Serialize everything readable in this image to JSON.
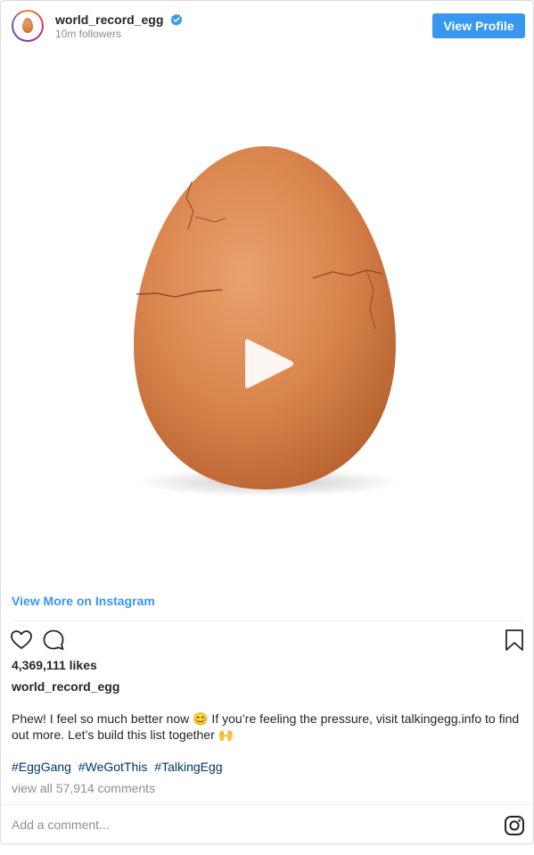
{
  "header": {
    "username": "world_record_egg",
    "followers": "10m followers",
    "view_profile_label": "View Profile",
    "verified_color": "#3897f0"
  },
  "media": {
    "type": "video",
    "play_icon": "play-icon"
  },
  "view_more_label": "View More on Instagram",
  "actions": {
    "like_icon": "heart-icon",
    "comment_icon": "comment-icon",
    "save_icon": "bookmark-icon"
  },
  "likes": "4,369,111 likes",
  "author": "world_record_egg",
  "caption": "Phew! I feel so much better now 😊 If you’re feeling the pressure, visit talkingegg.info to find out more. Let’s build this list together 🙌",
  "hashtags": [
    "#EggGang",
    "#WeGotThis",
    "#TalkingEgg"
  ],
  "view_comments": "view all 57,914 comments",
  "add_comment_placeholder": "Add a comment...",
  "colors": {
    "link_blue": "#3897f0",
    "hashtag": "#003569",
    "muted": "#8e8e8e",
    "text": "#262626"
  }
}
